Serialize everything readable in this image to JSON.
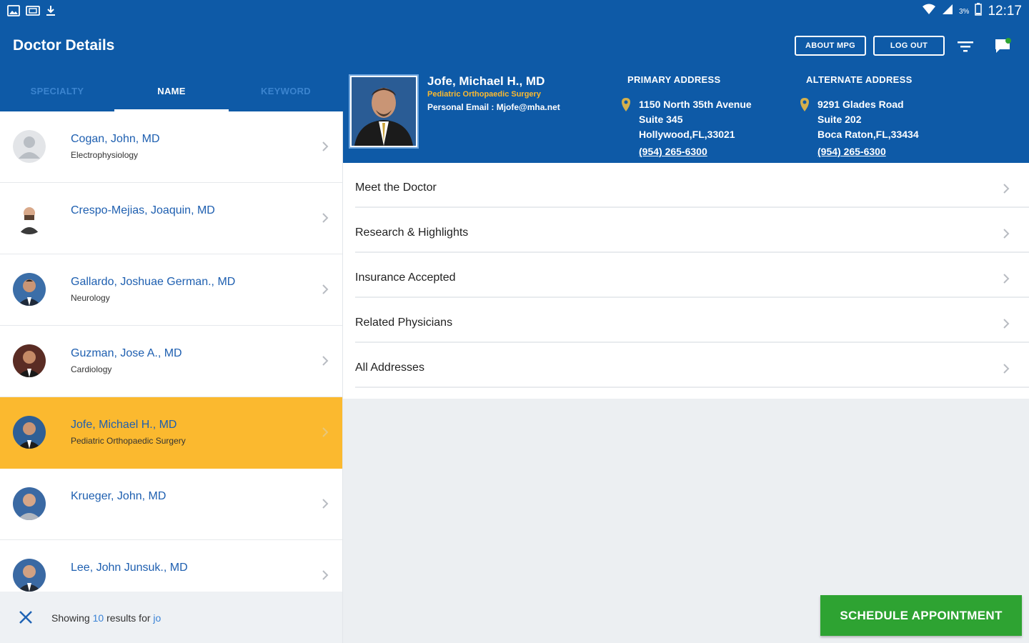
{
  "status_bar": {
    "time": "12:17",
    "battery_pct": "3%",
    "icons": [
      "gallery-icon",
      "screenshot-icon",
      "download-icon",
      "wifi-icon",
      "signal-icon",
      "battery-icon"
    ]
  },
  "header": {
    "title": "Doctor Details",
    "about_label": "ABOUT MPG",
    "logout_label": "LOG OUT",
    "icons": [
      "filter-icon",
      "chat-icon"
    ]
  },
  "tabs": [
    {
      "label": "SPECIALTY",
      "active": false
    },
    {
      "label": "NAME",
      "active": true
    },
    {
      "label": "KEYWORD",
      "active": false
    }
  ],
  "doctors": [
    {
      "name": "Cogan, John, MD",
      "specialty": "Electrophysiology",
      "selected": false
    },
    {
      "name": "Crespo-Mejias, Joaquin, MD",
      "specialty": "",
      "selected": false
    },
    {
      "name": "Gallardo, Joshuae German., MD",
      "specialty": "Neurology",
      "selected": false
    },
    {
      "name": "Guzman, Jose A., MD",
      "specialty": "Cardiology",
      "selected": false
    },
    {
      "name": "Jofe, Michael H., MD",
      "specialty": "Pediatric Orthopaedic Surgery",
      "selected": true
    },
    {
      "name": "Krueger, John, MD",
      "specialty": "",
      "selected": false
    },
    {
      "name": "Lee, John Junsuk., MD",
      "specialty": "",
      "selected": false
    }
  ],
  "footer": {
    "prefix": "Showing",
    "count": "10",
    "middle": "results for",
    "query": "jo"
  },
  "detail": {
    "name": "Jofe, Michael H., MD",
    "specialty": "Pediatric Orthopaedic Surgery",
    "email": "Personal Email : Mjofe@mha.net",
    "primary": {
      "heading": "PRIMARY ADDRESS",
      "line1": "1150 North 35th Avenue",
      "line2": "Suite 345",
      "line3": "Hollywood,FL,33021",
      "phone": "(954) 265-6300"
    },
    "alternate": {
      "heading": "ALTERNATE ADDRESS",
      "line1": "9291 Glades Road",
      "line2": "Suite 202",
      "line3": "Boca Raton,FL,33434",
      "phone": "(954) 265-6300"
    }
  },
  "menu": [
    "Meet the Doctor",
    "Research & Highlights",
    "Insurance Accepted",
    "Related Physicians",
    "All Addresses"
  ],
  "schedule_label": "SCHEDULE APPOINTMENT",
  "colors": {
    "primary_blue": "#0e5aa7",
    "selected_row": "#fbb92f",
    "link_blue": "#1e5fb0",
    "schedule_green": "#2ea332"
  }
}
